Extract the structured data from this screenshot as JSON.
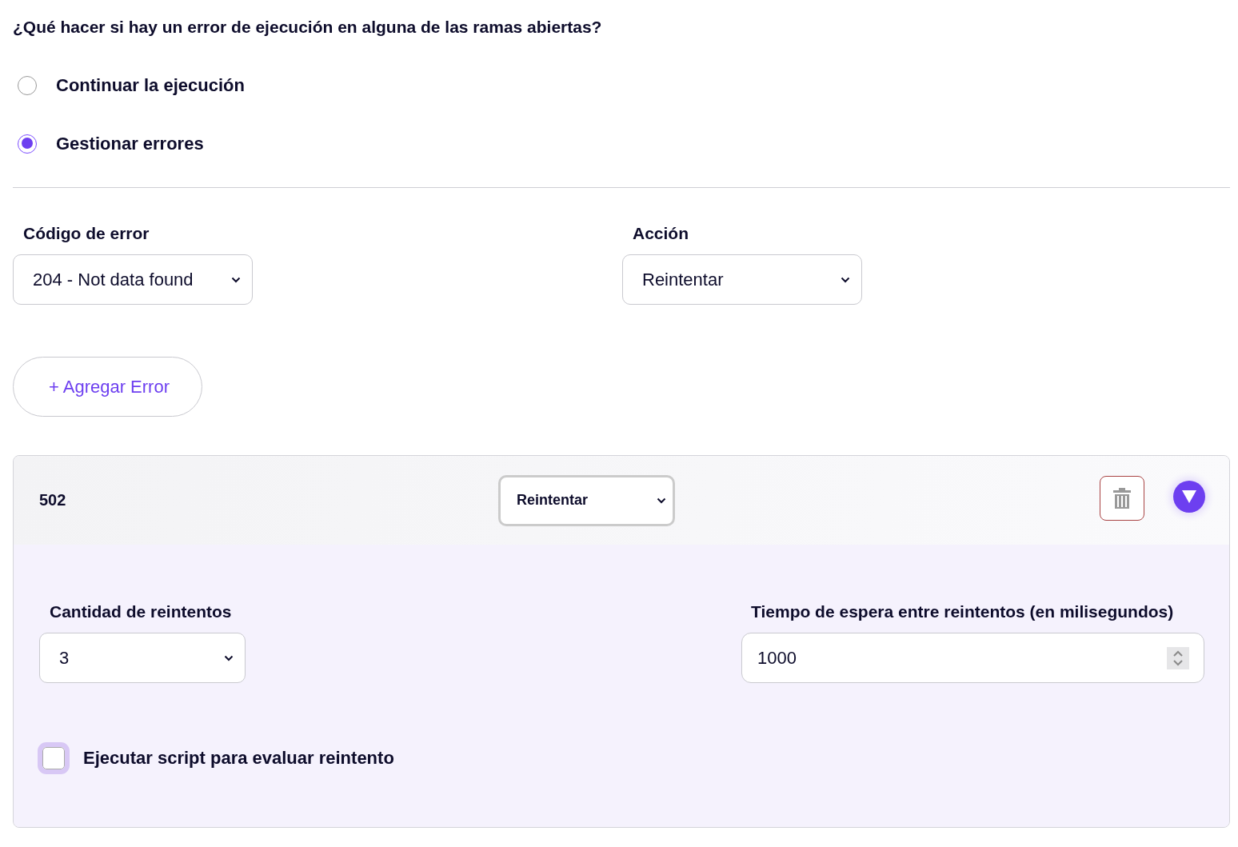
{
  "question": "¿Qué hacer si hay un error de ejecución en alguna de las ramas abiertas?",
  "options": [
    {
      "label": "Continuar la ejecución",
      "selected": false
    },
    {
      "label": "Gestionar errores",
      "selected": true
    }
  ],
  "error_code": {
    "label": "Código de error",
    "value": "204 - Not data found"
  },
  "action": {
    "label": "Acción",
    "value": "Reintentar"
  },
  "add_button": "+ Agregar Error",
  "error_card": {
    "code": "502",
    "action": "Reintentar",
    "expanded": true,
    "retry_count": {
      "label": "Cantidad de reintentos",
      "value": "3"
    },
    "wait_time": {
      "label": "Tiempo de espera entre reintentos (en milisegundos)",
      "value": "1000"
    },
    "script_option": {
      "label": "Ejecutar script para evaluar reintento",
      "checked": false
    }
  }
}
